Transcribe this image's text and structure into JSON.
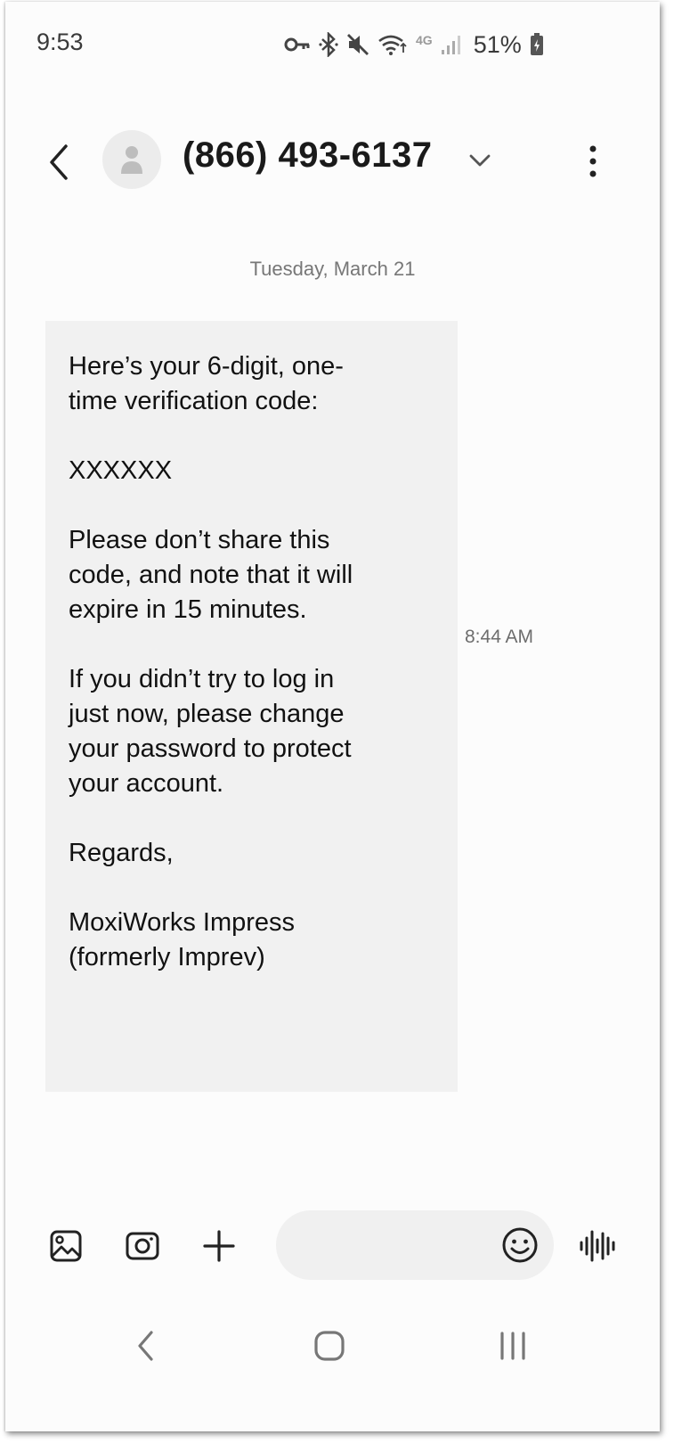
{
  "status_bar": {
    "time": "9:53",
    "network": "4G",
    "battery": "51%",
    "icons": [
      "vpn-key-icon",
      "bluetooth-icon",
      "mute-icon",
      "wifi-icon",
      "network-4g-icon",
      "signal-icon",
      "battery-icon"
    ]
  },
  "header": {
    "contact": "(866) 493-6137",
    "icons": [
      "back-icon",
      "avatar-icon",
      "chevron-down-icon",
      "more-vertical-icon"
    ]
  },
  "conversation": {
    "date": "Tuesday, March 21",
    "message": {
      "lines": [
        "Here’s your 6-digit, one-",
        "time verification code:",
        "",
        "XXXXXX",
        "",
        "Please don’t share this",
        "code, and note that it will",
        "expire in 15 minutes.",
        "",
        "If you didn’t try to log in",
        "just now, please change",
        "your password to protect",
        "your account.",
        "",
        "Regards,",
        "",
        "MoxiWorks Impress",
        "(formerly Imprev)"
      ],
      "time": "8:44 AM"
    }
  },
  "composer": {
    "input_value": "",
    "icons": [
      "gallery-icon",
      "camera-icon",
      "plus-icon",
      "emoji-icon",
      "voice-icon"
    ]
  },
  "nav_bar": {
    "icons": [
      "nav-back-icon",
      "home-icon",
      "recents-icon"
    ]
  },
  "colors": {
    "background": "#fcfcfc",
    "bubble": "#f1f1f1",
    "text": "#111111",
    "muted": "#777777"
  }
}
